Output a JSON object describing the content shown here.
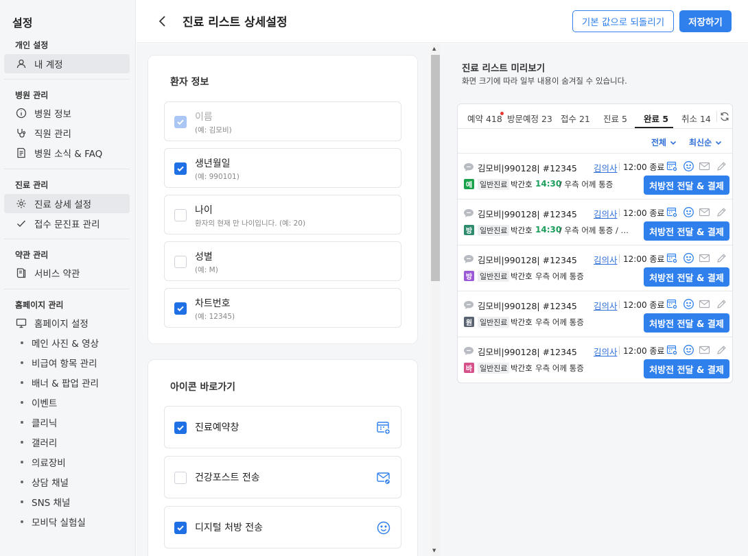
{
  "sidebar": {
    "title": "설정",
    "sections": [
      {
        "label": "개인 설정"
      },
      {
        "label": "병원 관리"
      },
      {
        "label": "진료 관리"
      },
      {
        "label": "약관 관리"
      },
      {
        "label": "홈페이지 관리"
      }
    ],
    "items": [
      {
        "label": "내 계정",
        "icon": "user-icon",
        "active": true
      },
      {
        "label": "병원 정보",
        "icon": "info-icon"
      },
      {
        "label": "직원 관리",
        "icon": "stethoscope-icon"
      },
      {
        "label": "병원 소식 & FAQ",
        "icon": "news-icon"
      },
      {
        "label": "진료 상세 설정",
        "icon": "gear-icon",
        "active": true
      },
      {
        "label": "접수 문진표 관리",
        "icon": "check-icon"
      },
      {
        "label": "서비스 약관",
        "icon": "book-icon"
      },
      {
        "label": "홈페이지 설정",
        "icon": "monitor-icon"
      }
    ],
    "homepage_subitems": [
      "메인 사진 & 영상",
      "비급여 항목 관리",
      "배너 & 팝업 관리",
      "이벤트",
      "클리닉",
      "갤러리",
      "의료장비",
      "상담 채널",
      "SNS 채널",
      "모비닥 실험실"
    ]
  },
  "header": {
    "title": "진료 리스트 상세설정",
    "reset_label": "기본 값으로 되돌리기",
    "save_label": "저장하기"
  },
  "patient_info": {
    "title": "환자 정보",
    "options": [
      {
        "label": "이름",
        "hint": "(예: 김모비)",
        "checked": true,
        "disabled": true
      },
      {
        "label": "생년월일",
        "hint": "(예: 990101)",
        "checked": true
      },
      {
        "label": "나이",
        "hint": "환자의 현재 만 나이입니다. (예: 20)",
        "checked": false
      },
      {
        "label": "성별",
        "hint": "(예: M)",
        "checked": false
      },
      {
        "label": "차트번호",
        "hint": "(예: 12345)",
        "checked": true
      }
    ]
  },
  "shortcuts": {
    "title": "아이콘 바로가기",
    "options": [
      {
        "label": "진료예약창",
        "icon": "calendar-plus-icon",
        "checked": true
      },
      {
        "label": "건강포스트 전송",
        "icon": "mail-edit-icon",
        "checked": false
      },
      {
        "label": "디지털 처방 전송",
        "icon": "smile-icon",
        "checked": true
      }
    ]
  },
  "preview": {
    "title": "진료 리스트 미리보기",
    "subtitle": "화면 크기에 따라 일부 내용이 숨겨질 수 있습니다.",
    "tabs": [
      "예약 418",
      "방문예정 23",
      "접수 21",
      "진료 5",
      "완료 5",
      "취소 14"
    ],
    "active_tab": "완료 5",
    "filter_all": "전체",
    "filter_sort": "최신순",
    "rows": [
      {
        "patient": "김모비|990128| #12345",
        "doctor": "김의사",
        "time": "12:00 종료",
        "badge": "예",
        "badge_color": "#1aa34a",
        "type": "일반진료",
        "nurse": "박간호",
        "scheduled": "14:30",
        "memo": "/ 우측 어께 통증",
        "action": "처방전 전달 & 결제"
      },
      {
        "patient": "김모비|990128| #12345",
        "doctor": "김의사",
        "time": "12:00 종료",
        "badge": "방",
        "badge_color": "#2e8b6e",
        "type": "일반진료",
        "nurse": "박간호",
        "scheduled": "14:30",
        "memo": "/ 우측 어께 통증 / …",
        "action": "처방전 전달 & 결제"
      },
      {
        "patient": "김모비|990128| #12345",
        "doctor": "김의사",
        "time": "12:00 종료",
        "badge": "방",
        "badge_color": "#9b59d6",
        "type": "일반진료",
        "nurse": "박간호",
        "scheduled": "",
        "memo": "우측 어께 통증",
        "action": "처방전 전달 & 결제"
      },
      {
        "patient": "김모비|990128| #12345",
        "doctor": "김의사",
        "time": "12:00 종료",
        "badge": "원",
        "badge_color": "#5a6372",
        "type": "일반진료",
        "nurse": "박간호",
        "scheduled": "",
        "memo": "우측 어께 통증",
        "action": "처방전 전달 & 결제"
      },
      {
        "patient": "김모비|990128| #12345",
        "doctor": "김의사",
        "time": "12:00 종료",
        "badge": "바",
        "badge_color": "#d6508a",
        "type": "일반진료",
        "nurse": "박간호",
        "scheduled": "",
        "memo": "우측 어께 통증",
        "action": "처방전 전달 & 결제"
      }
    ]
  }
}
